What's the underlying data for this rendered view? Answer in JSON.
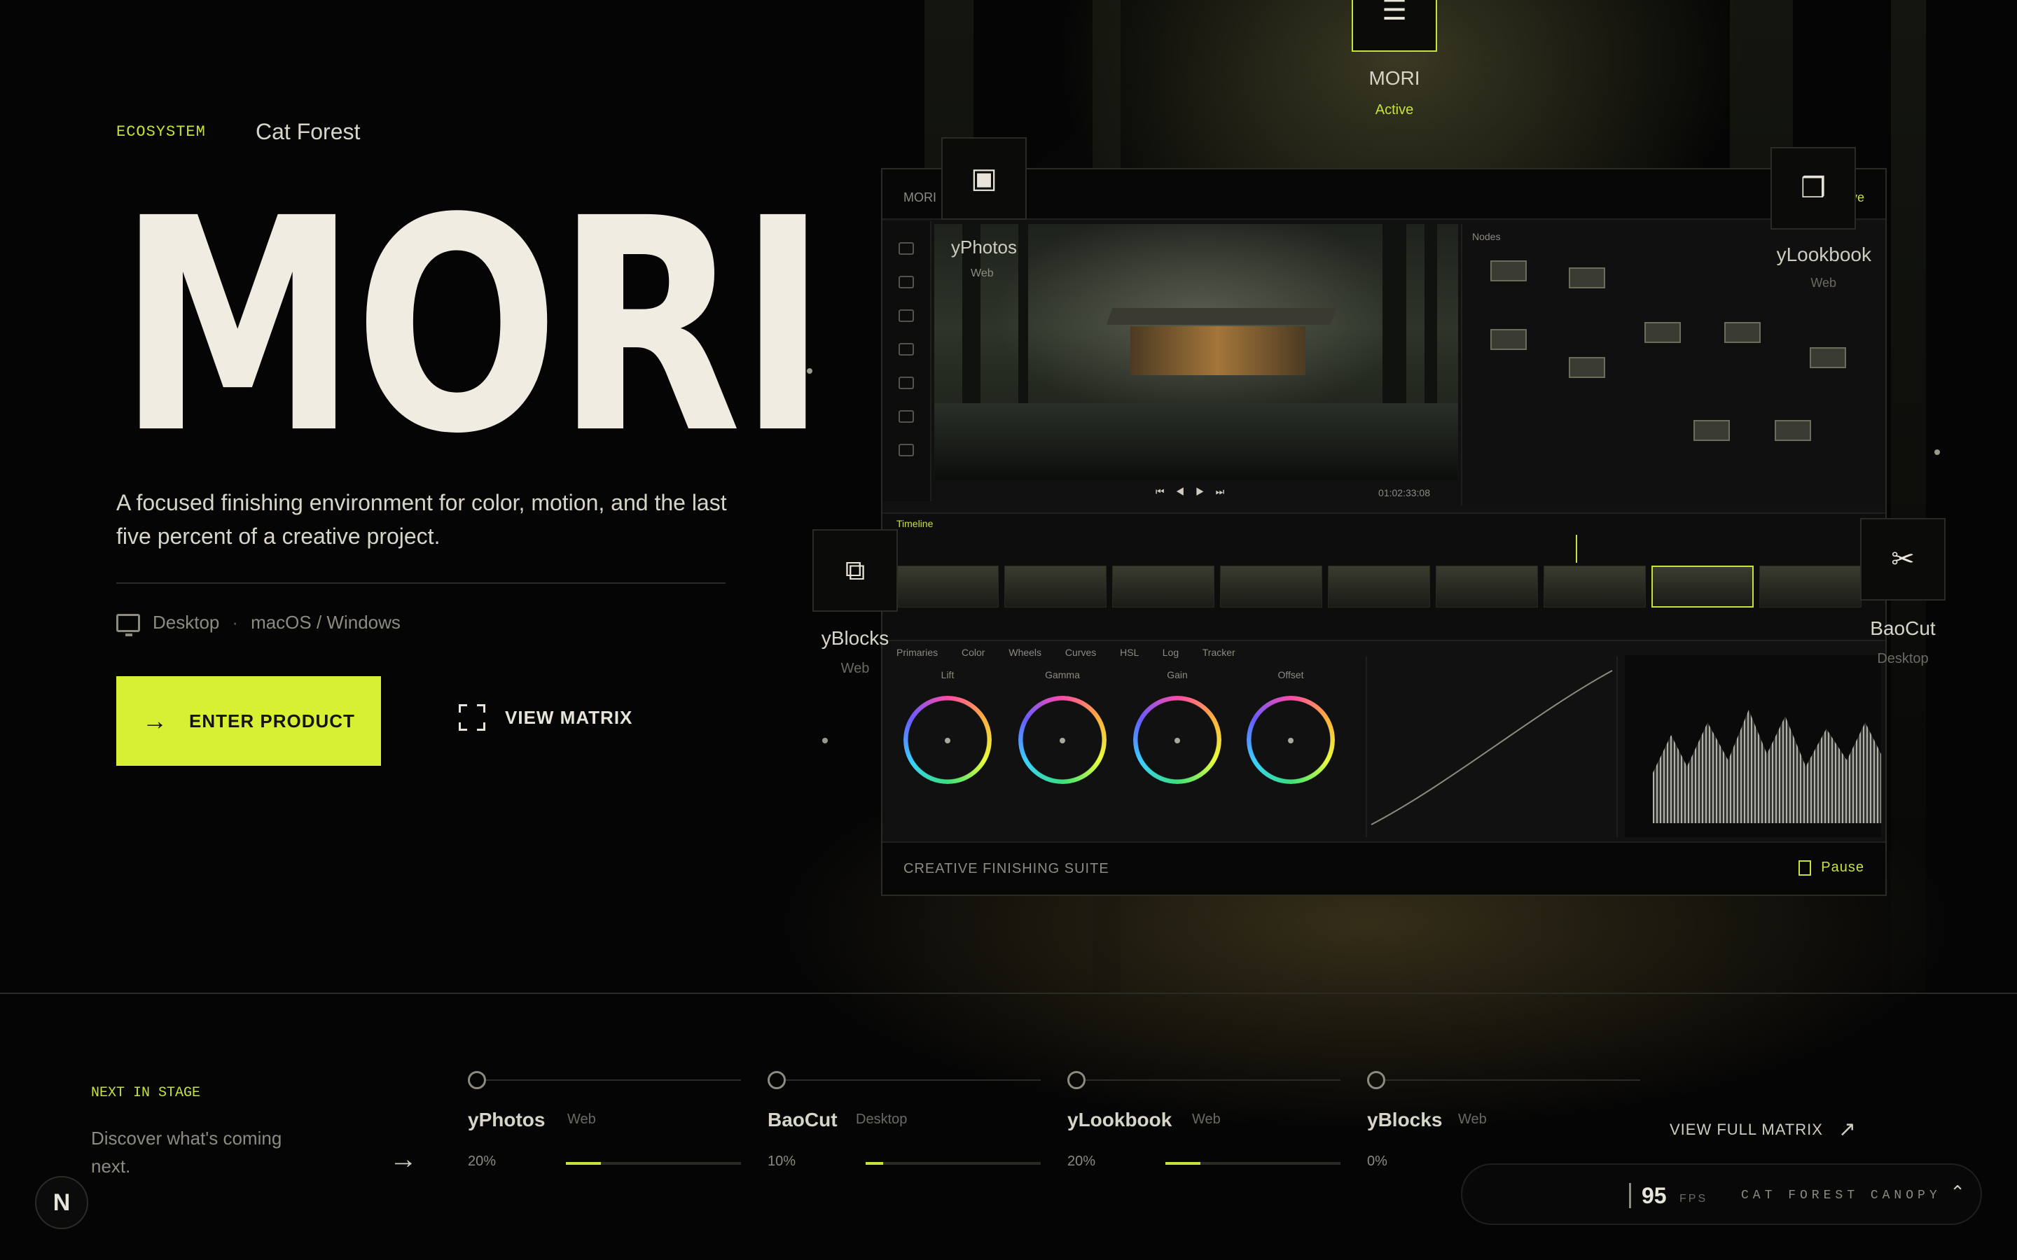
{
  "hero": {
    "eyebrow": "ECOSYSTEM",
    "breadcrumb": "Cat Forest",
    "title": "MORI",
    "description": "A focused finishing environment for color, motion, and the last five percent of a creative project.",
    "platform": "Desktop",
    "os": "macOS / Windows",
    "primary_cta": "ENTER PRODUCT",
    "secondary_cta": "VIEW MATRIX"
  },
  "nodes": {
    "top": {
      "name": "MORI",
      "status": "Active",
      "icon": "sliders-icon"
    },
    "photos": {
      "name": "yPhotos",
      "sub": "Web",
      "icon": "image-icon"
    },
    "lookbook": {
      "name": "yLookbook",
      "sub": "Web",
      "icon": "pages-icon"
    },
    "blocks": {
      "name": "yBlocks",
      "sub": "Web",
      "icon": "blocks-icon"
    },
    "baocut": {
      "name": "BaoCut",
      "sub": "Desktop",
      "icon": "scissors-icon"
    }
  },
  "app": {
    "topbar_left": "MORI",
    "topbar_right": "Live",
    "graph_title": "Nodes",
    "timeline_title": "Timeline",
    "timecode": "01:02:33:08",
    "grading_tabs": "Primaries Color Wheels Curves HSL Log Tracker",
    "wheels": [
      "Lift",
      "Gamma",
      "Gain",
      "Offset"
    ],
    "footer_label": "CREATIVE FINISHING SUITE",
    "pause_label": "Pause"
  },
  "stage": {
    "eyebrow": "NEXT IN STAGE",
    "description": "Discover what's coming next.",
    "items": [
      {
        "name": "yPhotos",
        "platform": "Web",
        "progress_label": "20%",
        "progress": 0.2
      },
      {
        "name": "BaoCut",
        "platform": "Desktop",
        "progress_label": "10%",
        "progress": 0.1
      },
      {
        "name": "yLookbook",
        "platform": "Web",
        "progress_label": "20%",
        "progress": 0.2
      },
      {
        "name": "yBlocks",
        "platform": "Web",
        "progress_label": "0%",
        "progress": 0
      }
    ],
    "view_full": "VIEW FULL MATRIX"
  },
  "status": {
    "fps_value": "95",
    "fps_unit": "FPS",
    "scene": "CAT FOREST CANOPY"
  },
  "badge": {
    "letter": "N"
  },
  "colors": {
    "accent": "#d7f034",
    "background": "#050505",
    "text": "#e8e4da"
  }
}
